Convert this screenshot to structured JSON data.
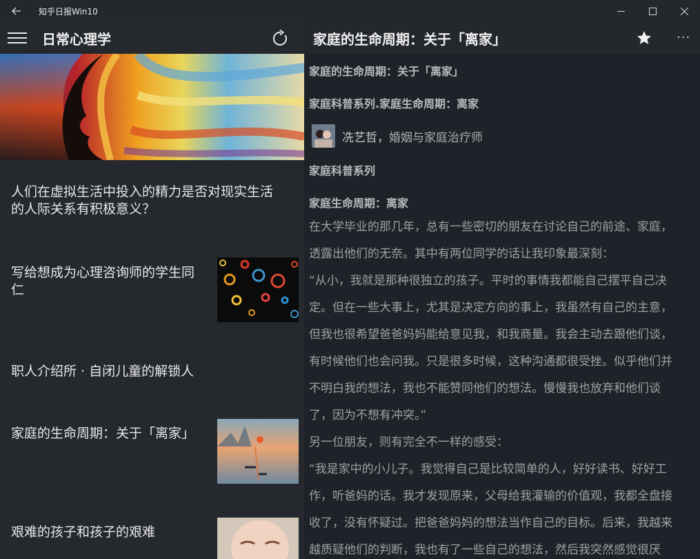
{
  "window": {
    "title": "知乎日报Win10"
  },
  "left": {
    "section_title": "日常心理学",
    "articles": [
      {
        "title_line1": "人们在虚拟生活中投入的精力是否对现实生活",
        "title_line2": "的人际关系有积极意义？"
      },
      {
        "title_line1": "写给想成为心理咨询师的学生同",
        "title_line2": "仁"
      },
      {
        "title_line1": "职人介绍所 · 自闭儿童的解锁人"
      },
      {
        "title_line1": "家庭的生命周期：关于「离家」"
      },
      {
        "title_line1": "艰难的孩子和孩子的艰难"
      }
    ]
  },
  "right": {
    "article_title": "家庭的生命周期：关于「离家」",
    "content": {
      "heading1": "家庭的生命周期：关于「离家」",
      "heading2": "家庭科普系列.家庭生命周期：离家",
      "author_name": "冼艺哲，",
      "author_bio": "婚姻与家庭治疗师",
      "heading3": "家庭科普系列",
      "heading4": "家庭生命周期：离家",
      "lines": [
        "在大学毕业的那几年，总有一些密切的朋友在讨论自己的前途、家庭，",
        "透露出他们的无奈。其中有两位同学的话让我印象最深刻：",
        "“从小，我就是那种很独立的孩子。平时的事情我都能自己摆平自己决",
        "定。但在一些大事上，尤其是决定方向的事上，我虽然有自己的主意，",
        "但我也很希望爸爸妈妈能给意见我，和我商量。我会主动去跟他们谈，",
        "有时候他们也会问我。只是很多时候，这种沟通都很受挫。似乎他们并",
        "不明白我的想法，我也不能赞同他们的想法。慢慢我也放弃和他们谈",
        "了，因为不想有冲突。”",
        "另一位朋友，则有完全不一样的感受：",
        "“我是家中的小儿子。我觉得自己是比较简单的人，好好读书、好好工",
        "作，听爸妈的话。我才发现原来，父母给我灌输的价值观，我都全盘接",
        "收了，没有怀疑过。把爸爸妈妈的想法当作自己的目标。后来，我越来",
        "越质疑他们的判断，我也有了一些自己的想法，然后我突然感觉很厌"
      ]
    }
  },
  "icons": {
    "back": "back-arrow-icon",
    "minimize": "minimize-icon",
    "maximize": "maximize-icon",
    "close": "close-icon",
    "menu": "hamburger-menu-icon",
    "refresh": "refresh-icon",
    "favorite": "star-icon",
    "more": "more-icon"
  }
}
